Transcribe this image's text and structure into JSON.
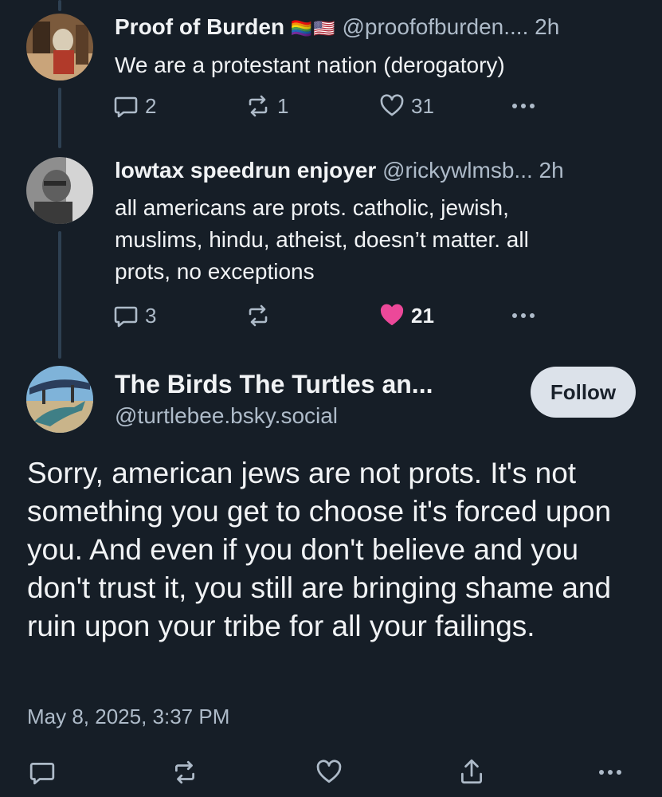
{
  "posts": [
    {
      "display_name": "Proof of Burden",
      "flags": "🏳️‍🌈🇺🇸",
      "handle": "@proofofburden....",
      "time": "2h",
      "text": "We are a protestant nation (derogatory)",
      "replies": "2",
      "reposts": "1",
      "likes": "31",
      "liked": false
    },
    {
      "display_name": "lowtax speedrun enjoyer",
      "handle": "@rickywlmsb...",
      "time": "2h",
      "text_lines": [
        "all americans are prots. catholic, jewish,",
        "muslims, hindu, atheist, doesn’t matter. all",
        "prots, no exceptions"
      ],
      "replies": "3",
      "reposts": "",
      "likes": "21",
      "liked": true
    }
  ],
  "main_post": {
    "display_name": "The Birds The Turtles an...",
    "handle": "@turtlebee.bsky.social",
    "follow_label": "Follow",
    "text": "Sorry, american jews are not prots. It's not something you get to choose it's forced upon you. And even if you don't believe and you don't trust it, you still are bringing shame and ruin upon your tribe for all your failings.",
    "timestamp": "May 8, 2025, 3:37 PM"
  },
  "colors": {
    "background": "#161e27",
    "text_primary": "#f1f3f5",
    "text_secondary": "#aebbc9",
    "like_active": "#ec4899",
    "thread_line": "#2e4052",
    "follow_bg": "#dce2ea"
  }
}
